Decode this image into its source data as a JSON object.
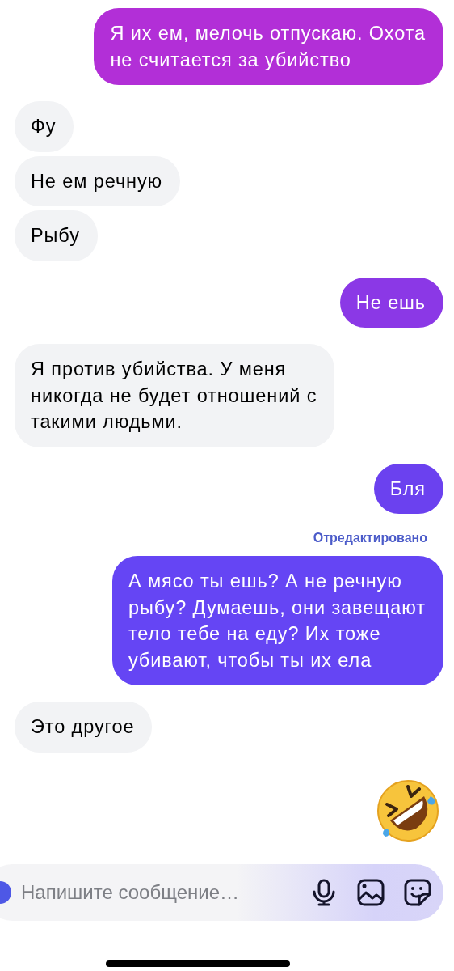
{
  "messages": [
    {
      "kind": "text",
      "outgoing": true,
      "color": "#b22fd7",
      "text": "Я их ем, мелочь отпускаю. Охота\nне считается за убийство"
    },
    {
      "kind": "text",
      "outgoing": false,
      "text": "Фу"
    },
    {
      "kind": "text",
      "outgoing": false,
      "text": "Не ем речную"
    },
    {
      "kind": "text",
      "outgoing": false,
      "text": "Рыбу"
    },
    {
      "kind": "text",
      "outgoing": true,
      "color": "#8b38e6",
      "text": "Не ешь"
    },
    {
      "kind": "text",
      "outgoing": false,
      "text": "Я против убийства. У меня\nникогда не будет отношений с\nтакими людьми."
    },
    {
      "kind": "text",
      "outgoing": true,
      "color": "#6b41ef",
      "text": "Бля"
    },
    {
      "kind": "text",
      "outgoing": true,
      "color": "#6545f4",
      "edited_label": "Отредактировано",
      "text": "А мясо ты ешь? А не речную\nрыбу? Думаешь, они завещают\nтело тебе на еду? Их тоже\nубивают, чтобы ты их ела"
    },
    {
      "kind": "text",
      "outgoing": false,
      "text": "Это другое"
    },
    {
      "kind": "sticker",
      "outgoing": true
    }
  ],
  "composer": {
    "placeholder": "Напишите сообщение…"
  }
}
